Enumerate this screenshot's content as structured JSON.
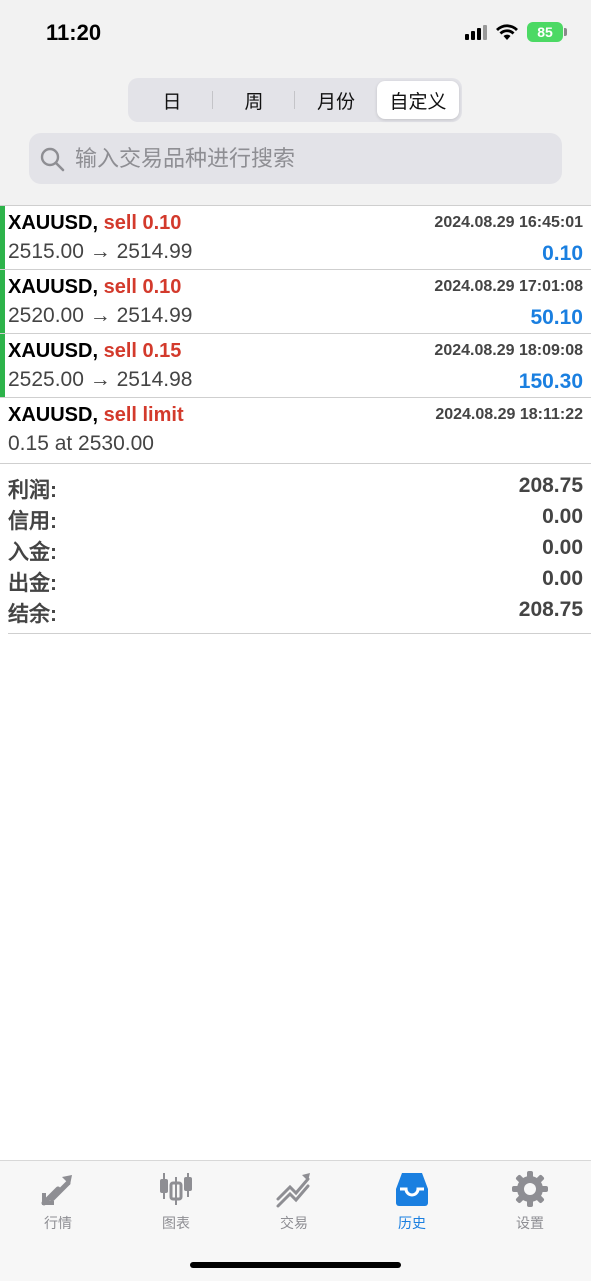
{
  "status_bar": {
    "time": "11:20",
    "battery": "85"
  },
  "segments": [
    {
      "label": "日",
      "active": false
    },
    {
      "label": "周",
      "active": false
    },
    {
      "label": "月份",
      "active": false
    },
    {
      "label": "自定义",
      "active": true
    }
  ],
  "search": {
    "placeholder": "输入交易品种进行搜索",
    "value": ""
  },
  "orders": [
    {
      "symbol": "XAUUSD,",
      "action": "sell 0.10",
      "time": "2024.08.29 16:45:01",
      "prices": "2515.00 → 2514.99",
      "profit": "0.10"
    },
    {
      "symbol": "XAUUSD,",
      "action": "sell 0.10",
      "time": "2024.08.29 17:01:08",
      "prices": "2520.00 → 2514.99",
      "profit": "50.10"
    },
    {
      "symbol": "XAUUSD,",
      "action": "sell 0.15",
      "time": "2024.08.29 18:09:08",
      "prices": "2525.00 → 2514.98",
      "profit": "150.30"
    },
    {
      "symbol": "XAUUSD,",
      "action": "sell limit",
      "time": "2024.08.29 18:11:22",
      "prices": "0.15 at 2530.00",
      "profit": ""
    }
  ],
  "summary": [
    {
      "label": "利润:",
      "value": "208.75"
    },
    {
      "label": "信用:",
      "value": "0.00"
    },
    {
      "label": "入金:",
      "value": "0.00"
    },
    {
      "label": "出金:",
      "value": "0.00"
    },
    {
      "label": "结余:",
      "value": "208.75"
    }
  ],
  "tabs": [
    {
      "label": "行情",
      "icon": "quotes-icon",
      "active": false
    },
    {
      "label": "图表",
      "icon": "chart-icon",
      "active": false
    },
    {
      "label": "交易",
      "icon": "trade-icon",
      "active": false
    },
    {
      "label": "历史",
      "icon": "history-icon",
      "active": true
    },
    {
      "label": "设置",
      "icon": "settings-icon",
      "active": false
    }
  ],
  "colors": {
    "accent": "#1a7fe0",
    "sell": "#d33a2c",
    "closed_bar": "#2db34a",
    "battery": "#4cd964"
  }
}
